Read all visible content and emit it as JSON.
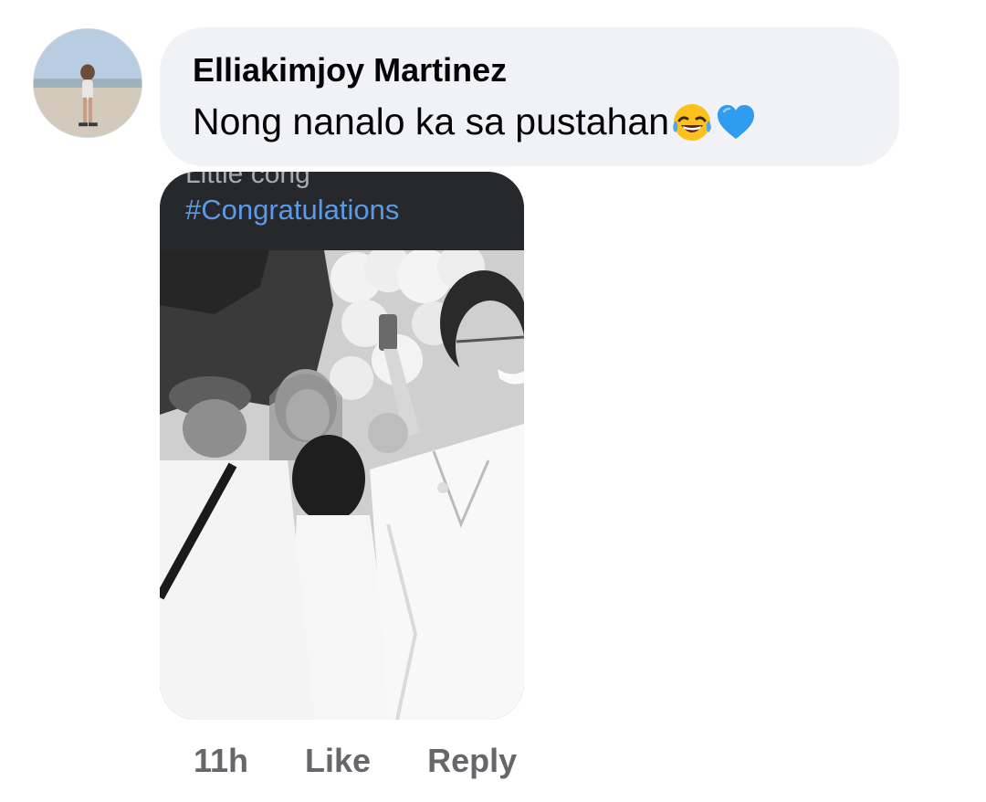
{
  "comment": {
    "author": "Elliakimjoy Martinez",
    "text": "Nong nanalo ka sa pustahan",
    "emojis": [
      "face-with-tears-of-joy-emoji",
      "blue-heart-emoji"
    ]
  },
  "attachment": {
    "partial_caption": "Little cong",
    "hashtag": "#Congratulations"
  },
  "actions": {
    "timestamp": "11h",
    "like_label": "Like",
    "reply_label": "Reply"
  },
  "colors": {
    "bubble": "#f0f2f5",
    "text": "#050505",
    "secondary_text": "#65676b",
    "hashtag": "#5b9ae6"
  }
}
